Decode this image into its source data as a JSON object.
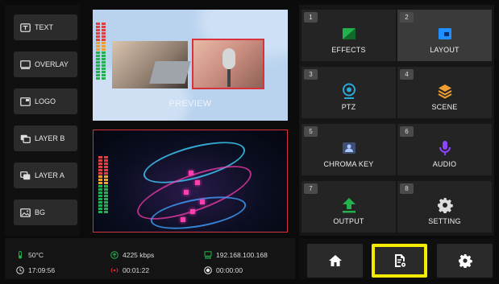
{
  "sources": [
    {
      "label": "TEXT",
      "icon": "text-icon"
    },
    {
      "label": "OVERLAY",
      "icon": "overlay-icon"
    },
    {
      "label": "LOGO",
      "icon": "logo-icon"
    },
    {
      "label": "LAYER B",
      "icon": "layer-b-icon"
    },
    {
      "label": "LAYER A",
      "icon": "layer-a-icon"
    },
    {
      "label": "BG",
      "icon": "image-icon"
    }
  ],
  "preview": {
    "label": "PREVIEW"
  },
  "status": {
    "temperature": "50°C",
    "time": "17:09:56",
    "bitrate": "4225 kbps",
    "stream_time": "00:01:22",
    "ip": "192.168.100.168",
    "record_time": "00:00:00"
  },
  "menu": [
    {
      "num": "1",
      "label": "EFFECTS",
      "icon": "effects-icon",
      "active": false
    },
    {
      "num": "2",
      "label": "LAYOUT",
      "icon": "layout-icon",
      "active": true
    },
    {
      "num": "3",
      "label": "PTZ",
      "icon": "ptz-camera-icon",
      "active": false
    },
    {
      "num": "4",
      "label": "SCENE",
      "icon": "scene-layers-icon",
      "active": false
    },
    {
      "num": "5",
      "label": "CHROMA KEY",
      "icon": "chroma-key-icon",
      "active": false
    },
    {
      "num": "6",
      "label": "AUDIO",
      "icon": "microphone-icon",
      "active": false
    },
    {
      "num": "7",
      "label": "OUTPUT",
      "icon": "output-upload-icon",
      "active": false
    },
    {
      "num": "8",
      "label": "SETTING",
      "icon": "gear-icon",
      "active": false
    }
  ],
  "bottom_nav": [
    {
      "icon": "home-icon"
    },
    {
      "icon": "document-settings-icon",
      "selected": true
    },
    {
      "icon": "gear-icon"
    }
  ],
  "colors": {
    "accent_green": "#22b14c",
    "accent_blue": "#1e90ff",
    "accent_purple": "#8e44ff",
    "record_red": "#e0263a",
    "highlight_yellow": "#f5ea00",
    "tally_red": "#d8323c"
  }
}
